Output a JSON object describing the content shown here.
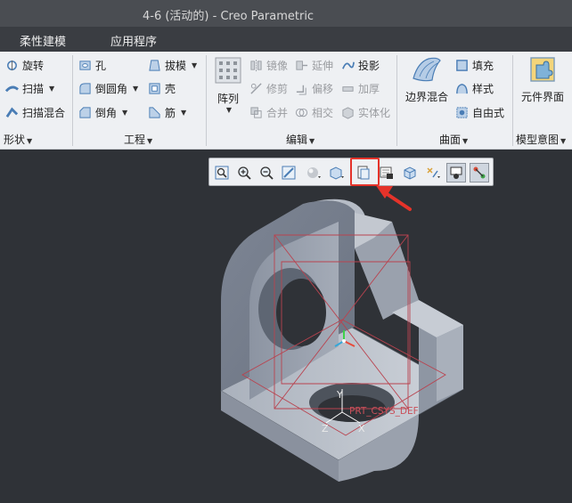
{
  "window": {
    "title": "4-6 (活动的) - Creo Parametric"
  },
  "menubar": {
    "tabs": [
      "柔性建模",
      "应用程序"
    ]
  },
  "ribbon": {
    "shape": {
      "items": [
        "旋转",
        "扫描",
        "扫描混合"
      ],
      "label": "形状"
    },
    "engineering": {
      "items": [
        "孔",
        "倒圆角",
        "倒角",
        "拔模",
        "壳",
        "筋"
      ],
      "label": "工程"
    },
    "editing": {
      "pattern_label": "阵列",
      "items": [
        "镜像",
        "延伸",
        "投影",
        "修剪",
        "偏移",
        "加厚",
        "合并",
        "相交",
        "实体化"
      ],
      "label": "编辑"
    },
    "surfaces": {
      "boundary_blend": "边界混合",
      "items": [
        "填充",
        "样式",
        "自由式"
      ],
      "label": "曲面"
    },
    "model_intent": {
      "component_interface": "元件界面",
      "label": "模型意图"
    }
  },
  "graphics": {
    "datum_labels": {
      "csys": "PRT_CSYS_DEF",
      "x": "X",
      "y": "Y",
      "z": "Z"
    },
    "toolbar_icons": [
      "refit-icon",
      "zoom-in-icon",
      "zoom-out-icon",
      "repaint-icon",
      "display-style-icon",
      "saved-views-icon",
      "view-manager-icon",
      "spin-center-icon",
      "orient-icon",
      "datum-display-icon",
      "annotation-display-icon",
      "appearance-icon"
    ],
    "highlight_color": "#e5332a"
  }
}
